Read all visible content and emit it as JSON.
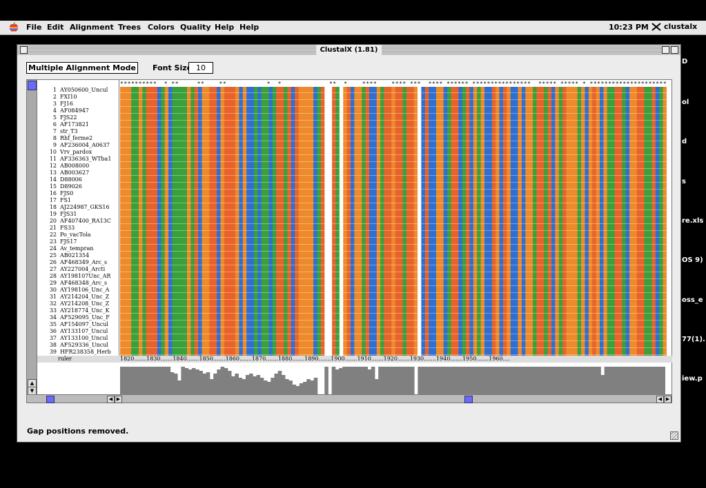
{
  "menubar": {
    "items": [
      "File",
      "Edit",
      "Alignment",
      "Trees",
      "Colors",
      "Quality",
      "Help",
      "Help"
    ],
    "clock": "10:23 PM",
    "app_name": "clustalx"
  },
  "desktop_labels": [
    "D",
    "ol",
    "d",
    "s",
    "re.xls",
    "OS 9)",
    "oss_e",
    "77(1).",
    "iew.p"
  ],
  "window": {
    "title": "ClustalX (1.81)",
    "mode_button": "Multiple Alignment Mode",
    "font_size_label": "Font Size:",
    "font_size_value": "10",
    "status": "Gap positions removed."
  },
  "alignment": {
    "consensus": "**********  * **     **    **           *  *             **  *    ****    **** ***  **** ****** ****************  ***** ***** * *********************",
    "sequences": [
      {
        "num": "1",
        "name": "AY050600_Uncul"
      },
      {
        "num": "2",
        "name": "FXI10"
      },
      {
        "num": "3",
        "name": "FJ16"
      },
      {
        "num": "4",
        "name": "AF084947"
      },
      {
        "num": "5",
        "name": "FJS22"
      },
      {
        "num": "6",
        "name": "AF173821"
      },
      {
        "num": "7",
        "name": "str_T3"
      },
      {
        "num": "8",
        "name": "Rhf_ferme2"
      },
      {
        "num": "9",
        "name": "AF236004_A0637"
      },
      {
        "num": "10",
        "name": "Vrv_pardox"
      },
      {
        "num": "11",
        "name": "AF336363_WTba1"
      },
      {
        "num": "12",
        "name": "AB008000"
      },
      {
        "num": "13",
        "name": "AB003627"
      },
      {
        "num": "14",
        "name": "D88006"
      },
      {
        "num": "15",
        "name": "D89026"
      },
      {
        "num": "16",
        "name": "FJS0"
      },
      {
        "num": "17",
        "name": "FS1"
      },
      {
        "num": "18",
        "name": "AJ224987_GKS16"
      },
      {
        "num": "19",
        "name": "FJS31"
      },
      {
        "num": "20",
        "name": "AF407400_RA13C"
      },
      {
        "num": "21",
        "name": "FS33"
      },
      {
        "num": "22",
        "name": "Po_vacTola"
      },
      {
        "num": "23",
        "name": "FJS17"
      },
      {
        "num": "24",
        "name": "Av_tempran"
      },
      {
        "num": "25",
        "name": "AB021354"
      },
      {
        "num": "26",
        "name": "AF468349_Arc_s"
      },
      {
        "num": "27",
        "name": "AY227004_Arcti"
      },
      {
        "num": "28",
        "name": "AY198107Unc_AR"
      },
      {
        "num": "29",
        "name": "AF468348_Arc_s"
      },
      {
        "num": "30",
        "name": "AY198106_Unc_A"
      },
      {
        "num": "31",
        "name": "AY214204_Unc_Z"
      },
      {
        "num": "32",
        "name": "AY214208_Unc_Z"
      },
      {
        "num": "33",
        "name": "AY218774_Unc_K"
      },
      {
        "num": "34",
        "name": "AF529095_Unc_F"
      },
      {
        "num": "35",
        "name": "AF154097_Uncul"
      },
      {
        "num": "36",
        "name": "AY133107_Uncul"
      },
      {
        "num": "37",
        "name": "AY133100_Uncul"
      },
      {
        "num": "38",
        "name": "AF529336_Uncul"
      },
      {
        "num": "39",
        "name": "HFR238358_Herb"
      }
    ],
    "ruler_label": "ruler",
    "ruler": "1820.......1830.......1840.......1850.......1860.......1870.......1880.......1890.......1900.......1910.......1920.......1930.......1940.......1950.......1960....",
    "colors": {
      "A": "#e8632a",
      "C": "#2e6fd1",
      "G": "#ee8a2a",
      "T": "#3aa03a",
      "gap": "#ffffff"
    }
  }
}
